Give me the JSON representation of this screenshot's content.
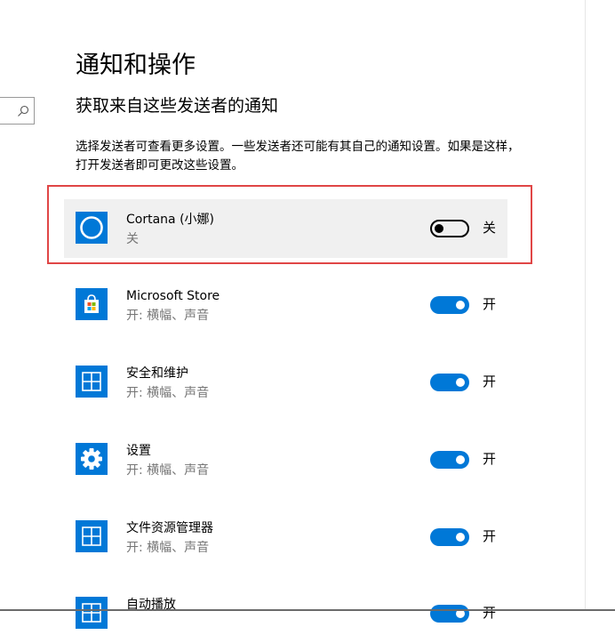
{
  "page": {
    "title": "通知和操作",
    "section_title": "获取来自这些发送者的通知",
    "description": "选择发送者可查看更多设置。一些发送者还可能有其自己的通知设置。如果是这样，打开发送者即可更改这些设置。"
  },
  "search": {
    "icon": "search-icon"
  },
  "senders": [
    {
      "name": "Cortana (小娜)",
      "status": "关",
      "toggle_state": "关",
      "on": false,
      "icon": "cortana-icon"
    },
    {
      "name": "Microsoft Store",
      "status": "开: 横幅、声音",
      "toggle_state": "开",
      "on": true,
      "icon": "store-icon"
    },
    {
      "name": "安全和维护",
      "status": "开: 横幅、声音",
      "toggle_state": "开",
      "on": true,
      "icon": "window-app-icon"
    },
    {
      "name": "设置",
      "status": "开: 横幅、声音",
      "toggle_state": "开",
      "on": true,
      "icon": "gear-icon"
    },
    {
      "name": "文件资源管理器",
      "status": "开: 横幅、声音",
      "toggle_state": "开",
      "on": true,
      "icon": "window-app-icon"
    },
    {
      "name": "自动播放",
      "status": "",
      "toggle_state": "开",
      "on": true,
      "icon": "window-app-icon"
    }
  ],
  "colors": {
    "accent": "#0078d7",
    "highlight_border": "#e04646",
    "secondary_text": "#767676",
    "selected_row": "#f0f0f0"
  }
}
